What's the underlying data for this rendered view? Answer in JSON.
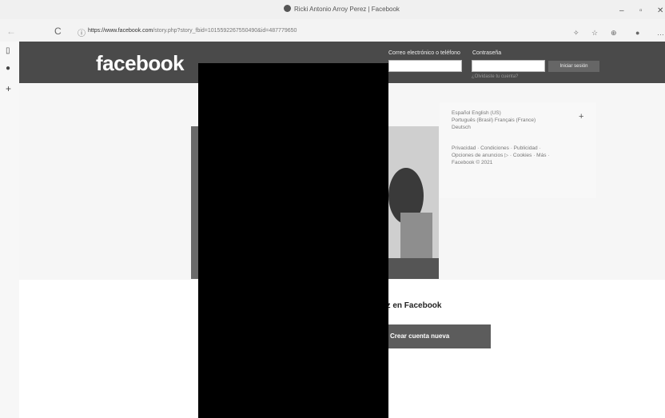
{
  "browser": {
    "title": "Ricki Antonio Arroy Perez | Facebook",
    "url_host": "https://www.facebook.com",
    "url_path": "/story.php?story_fbid=1015592267550490&id=487779650",
    "minimize_glyph": "–",
    "maximize_glyph": "▫",
    "close_glyph": "✕",
    "back_glyph": "←",
    "reload_glyph": "C",
    "info_glyph": "ⓘ",
    "toolbar_glyphs": [
      "✧",
      "☆",
      "⊕",
      "●"
    ],
    "more_glyph": "…",
    "sidebar_glyphs": [
      "▯",
      "●",
      "+"
    ]
  },
  "header": {
    "logo": "facebook",
    "email_label": "Correo electrónico o teléfono",
    "password_label": "Contraseña",
    "login_button": "Iniciar sesión",
    "forgot_link": "¿Olvidaste tu cuenta?"
  },
  "side_panel": {
    "languages_line1": "Español  English (US)",
    "languages_line2": "Português (Brasil)  Français (France)",
    "languages_line3": "Deutsch",
    "plus": "+",
    "footer_line1": "Privacidad · Condiciones · Publicidad ·",
    "footer_line2": "Opciones de anuncios ▷ · Cookies · Más ·",
    "footer_line3": "Facebook © 2021"
  },
  "signup": {
    "heading": "ez en Facebook",
    "button": "Crear cuenta nueva"
  },
  "colors": {
    "topbar": "#4a4a4a",
    "button": "#5c5c5c",
    "redaction": "#000000"
  }
}
